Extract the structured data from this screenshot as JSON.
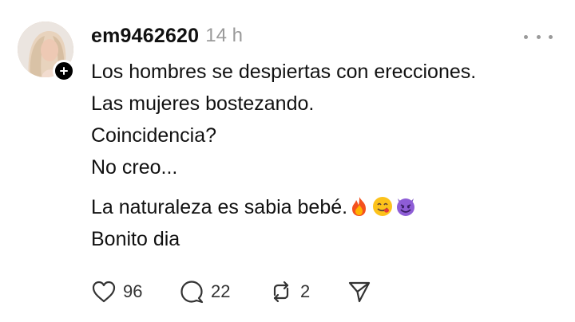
{
  "post": {
    "username": "em9462620",
    "timestamp": "14 h",
    "lines": [
      "Los hombres se despiertas con erecciones.",
      "Las mujeres bostezando.",
      "Coincidencia?",
      "No creo...",
      "La naturaleza es sabia bebé.",
      "Bonito dia"
    ],
    "emojis": [
      "fire-emoji",
      "yum-emoji",
      "smiling-devil-emoji"
    ],
    "actions": {
      "like_count": "96",
      "reply_count": "22",
      "repost_count": "2"
    }
  },
  "icons": [
    "heart-icon",
    "comment-icon",
    "repost-icon",
    "share-icon",
    "more-icon",
    "plus-icon"
  ],
  "colors": {
    "text": "#111111",
    "muted": "#9a9a9a",
    "icon": "#333333"
  }
}
